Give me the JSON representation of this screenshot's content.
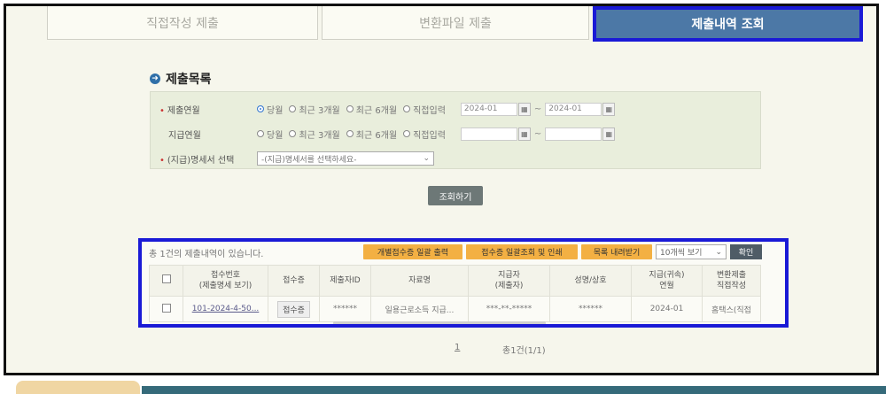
{
  "tabs": [
    "직접작성 제출",
    "변환파일 제출",
    "제출내역 조회"
  ],
  "section_title": "제출목록",
  "filter": {
    "row1": {
      "label": "제출연월",
      "options": [
        "당월",
        "최근 3개월",
        "최근 6개월",
        "직접입력"
      ],
      "selected": 0,
      "from": "2024-01",
      "to": "2024-01"
    },
    "row2": {
      "label": "지급연월",
      "options": [
        "당월",
        "최근 3개월",
        "최근 6개월",
        "직접입력"
      ],
      "from": "",
      "to": ""
    },
    "row3": {
      "label": "(지급)명세서 선택",
      "placeholder": "-(지급)명세서를 선택하세요-"
    }
  },
  "search_button": "조회하기",
  "results": {
    "summary": "총 1건의 제출내역이 있습니다.",
    "buttons": [
      "개별접수증 일괄 출력",
      "접수증 일괄조회 및 인쇄",
      "목록 내려받기"
    ],
    "page_size": "10개씩 보기",
    "confirm": "확인",
    "headers": [
      [
        "접수번호",
        "(제출명세 보기)"
      ],
      [
        "접수증"
      ],
      [
        "제출자ID"
      ],
      [
        "자료명"
      ],
      [
        "지급자",
        "(제출자)"
      ],
      [
        "성명/상호"
      ],
      [
        "지급(귀속)",
        "연월"
      ],
      [
        "변환제출",
        "직접작성"
      ]
    ],
    "row": {
      "receipt_no": "101-2024-4-50...",
      "receipt_btn": "접수증",
      "submitter_id": "******",
      "data_name": "일용근로소득 지급...",
      "payer": "***-**-*****",
      "name": "******",
      "period": "2024-01",
      "method": "홈택스(직접"
    }
  },
  "pager": {
    "page": "1",
    "total": "총1건(1/1)"
  },
  "colors": {
    "active_tab": "#4c78a6",
    "highlight": "#1a1ad6",
    "orange_btn": "#f3b043"
  }
}
